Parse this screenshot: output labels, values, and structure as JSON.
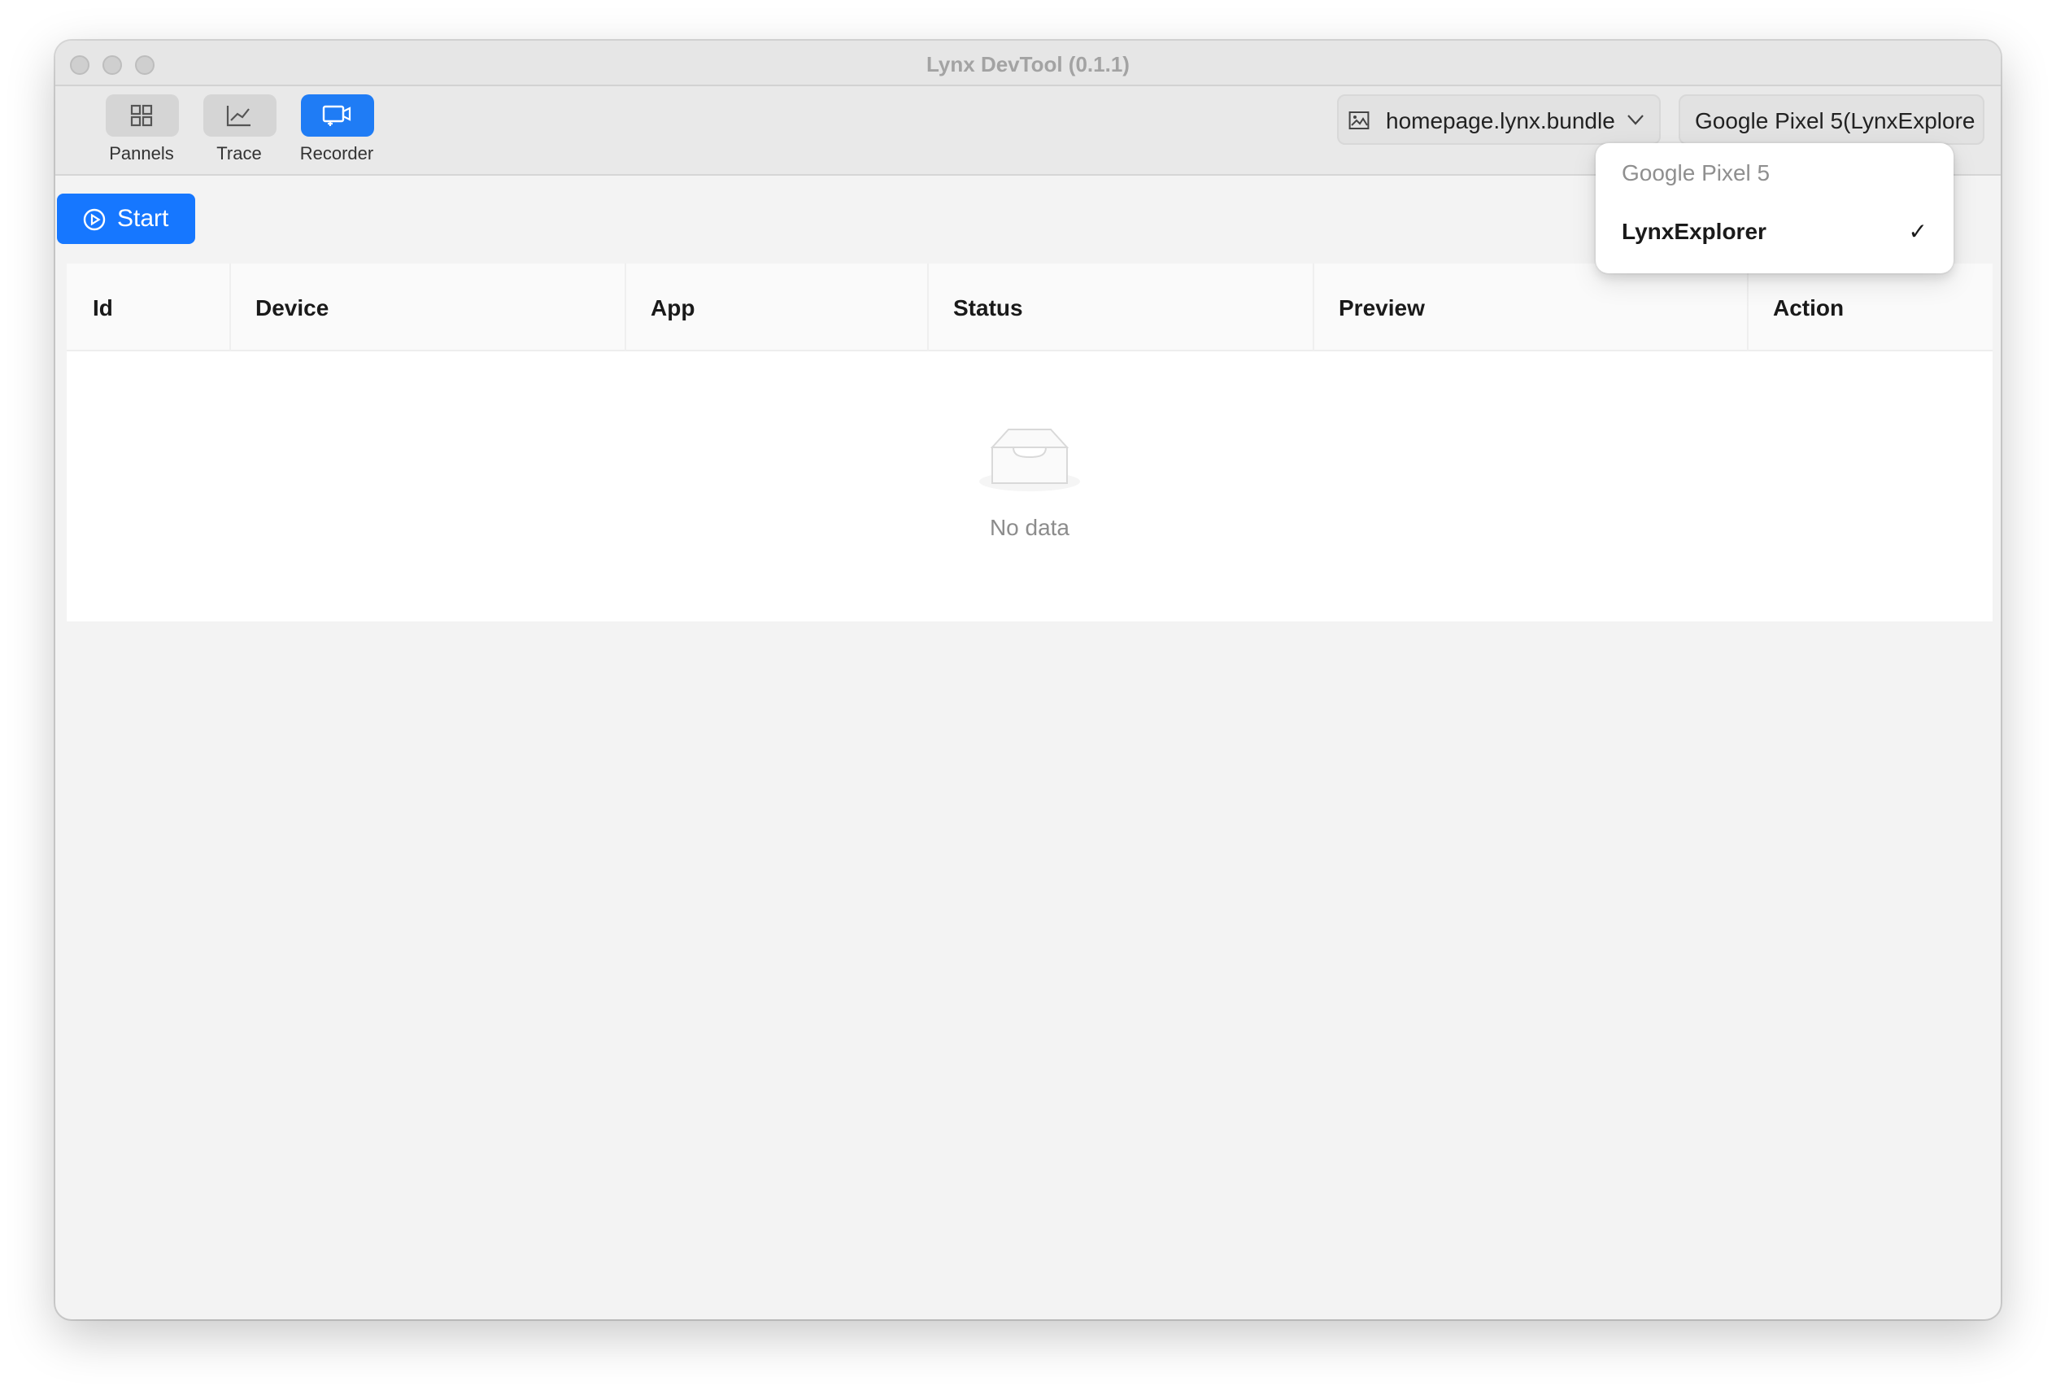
{
  "window": {
    "title": "Lynx DevTool (0.1.1)"
  },
  "toolbar": {
    "tools": [
      {
        "label": "Pannels",
        "icon": "grid-icon"
      },
      {
        "label": "Trace",
        "icon": "line-chart-icon"
      },
      {
        "label": "Recorder",
        "icon": "screen-record-icon",
        "active": true
      }
    ],
    "file_select": {
      "value": "homepage.lynx.bundle",
      "icon": "image-icon"
    },
    "device_select": {
      "value": "Google Pixel 5(LynxExplore"
    }
  },
  "actions": {
    "start_label": "Start"
  },
  "table": {
    "columns": [
      "Id",
      "Device",
      "App",
      "Status",
      "Preview",
      "Action"
    ],
    "rows": [],
    "empty_text": "No data"
  },
  "device_dropdown": {
    "items": [
      {
        "label": "Google Pixel 5",
        "disabled": true
      },
      {
        "label": "LynxExplorer",
        "selected": true
      }
    ],
    "check_glyph": "✓"
  },
  "colors": {
    "accent": "#1677ff",
    "window_bg": "#f3f3f3",
    "toolbar_bg": "#e9e9e9"
  }
}
